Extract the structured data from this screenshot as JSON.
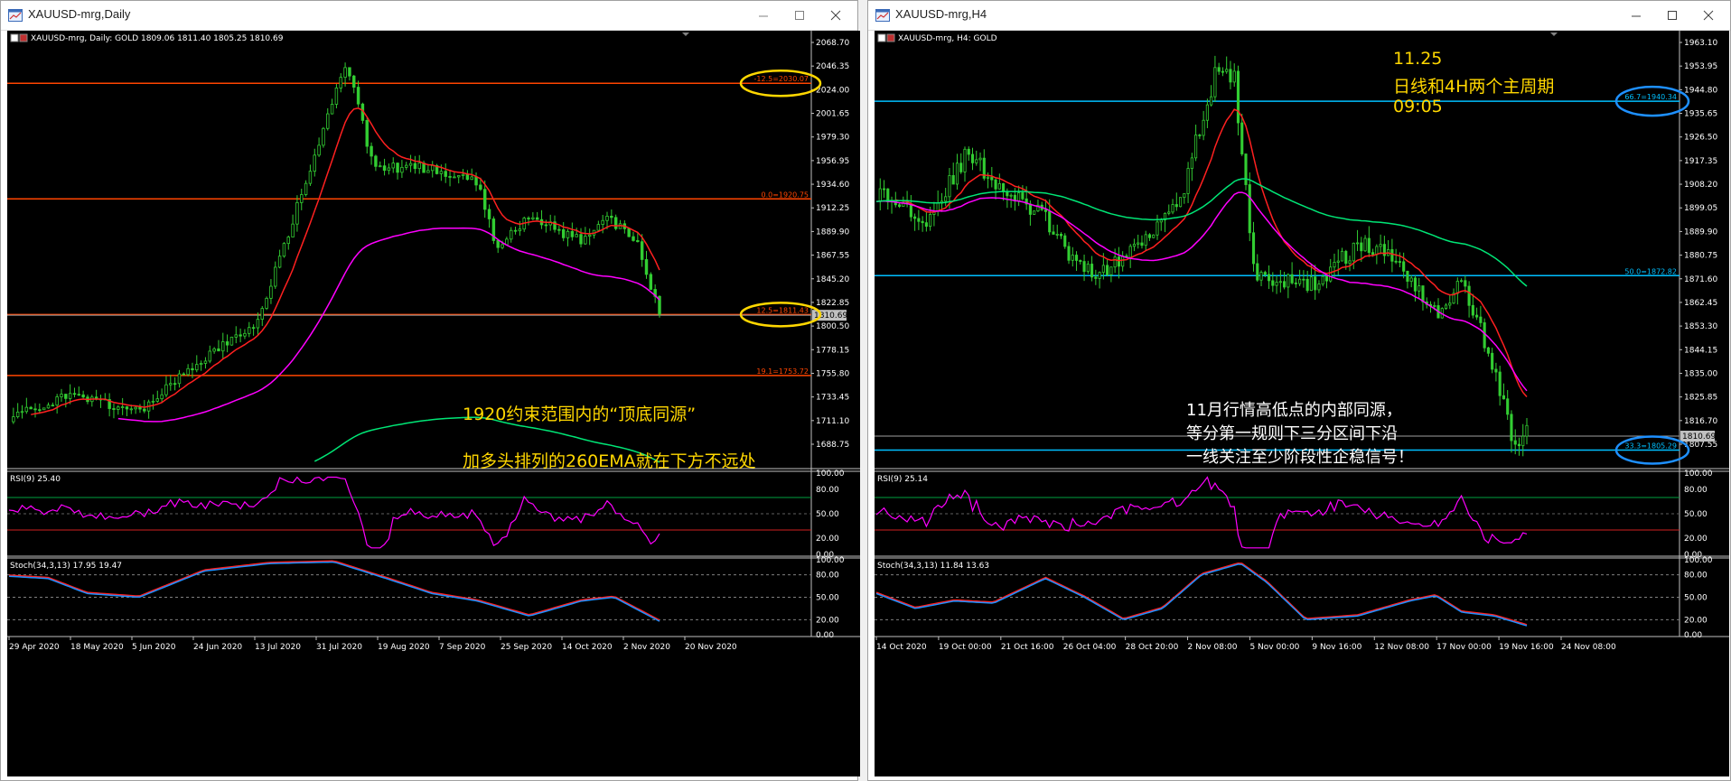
{
  "left_window": {
    "title": "XAUUSD-mrg,Daily",
    "chart_header": "XAUUSD-mrg, Daily:  GOLD  1809.06 1811.40 1805.25 1810.69",
    "price_axis": [
      "2068.70",
      "2046.35",
      "2024.00",
      "2001.65",
      "1979.30",
      "1956.95",
      "1934.60",
      "1912.25",
      "1889.90",
      "1867.55",
      "1845.20",
      "1822.85",
      "1800.50",
      "1778.15",
      "1755.80",
      "1733.45",
      "1711.10",
      "1688.75"
    ],
    "current_price": "1810.69",
    "fib_labels": [
      "-12.5=2030.07",
      "0.0=1920.75",
      "12.5=1811.43",
      "19.1=1753.72"
    ],
    "annotation_line1": "1920约束范围内的“顶底同源”",
    "annotation_line2": "加多头排列的260EMA就在下方不远处",
    "rsi_label": "RSI(9) 25.40",
    "rsi_levels": [
      "100.00",
      "80.00",
      "50.00",
      "20.00",
      "0.00"
    ],
    "stoch_label": "Stoch(34,3,13) 17.95 19.47",
    "stoch_levels": [
      "100.00",
      "80.00",
      "50.00",
      "20.00",
      "0.00"
    ],
    "time_axis": [
      "29 Apr 2020",
      "18 May 2020",
      "5 Jun 2020",
      "24 Jun 2020",
      "13 Jul 2020",
      "31 Jul 2020",
      "19 Aug 2020",
      "7 Sep 2020",
      "25 Sep 2020",
      "14 Oct 2020",
      "2 Nov 2020",
      "20 Nov 2020"
    ]
  },
  "right_window": {
    "title": "XAUUSD-mrg,H4",
    "chart_header": "XAUUSD-mrg, H4:  GOLD",
    "price_axis": [
      "1963.10",
      "1953.95",
      "1944.80",
      "1935.65",
      "1926.50",
      "1917.35",
      "1908.20",
      "1899.05",
      "1889.90",
      "1880.75",
      "1871.60",
      "1862.45",
      "1853.30",
      "1844.15",
      "1835.00",
      "1825.85",
      "1816.70",
      "1807.55"
    ],
    "current_price": "1810.69",
    "fib_labels": [
      "66.7=1940.34",
      "50.0=1872.82",
      "33.3=1805.29"
    ],
    "date_note": [
      "11.25",
      "日线和4H两个主周期",
      "09:05"
    ],
    "annotation_lines": [
      "11月行情高低点的内部同源，",
      "等分第一规则下三分区间下沿",
      "一线关注至少阶段性企稳信号！"
    ],
    "rsi_label": "RSI(9) 25.14",
    "rsi_levels": [
      "100.00",
      "80.00",
      "50.00",
      "20.00",
      "0.00"
    ],
    "stoch_label": "Stoch(34,3,13) 11.84 13.63",
    "stoch_levels": [
      "100.00",
      "80.00",
      "50.00",
      "20.00",
      "0.00"
    ],
    "time_axis": [
      "14 Oct 2020",
      "19 Oct 00:00",
      "21 Oct 16:00",
      "26 Oct 04:00",
      "28 Oct 20:00",
      "2 Nov 08:00",
      "5 Nov 00:00",
      "9 Nov 16:00",
      "12 Nov 08:00",
      "17 Nov 00:00",
      "19 Nov 16:00",
      "24 Nov 08:00"
    ]
  },
  "colors": {
    "chart_background": "#000000",
    "candles": "#32cd32",
    "ema_short": "#ff2020",
    "ema_mid": "#ff00ff",
    "ema_long": "#00e676",
    "fib_left": "#ff4500",
    "fib_right": "#00bfff",
    "annotation_yellow": "#ffd700",
    "annotation_white": "#ffffff",
    "circle_yellow": "#ffd700",
    "circle_blue": "#1e90ff"
  }
}
